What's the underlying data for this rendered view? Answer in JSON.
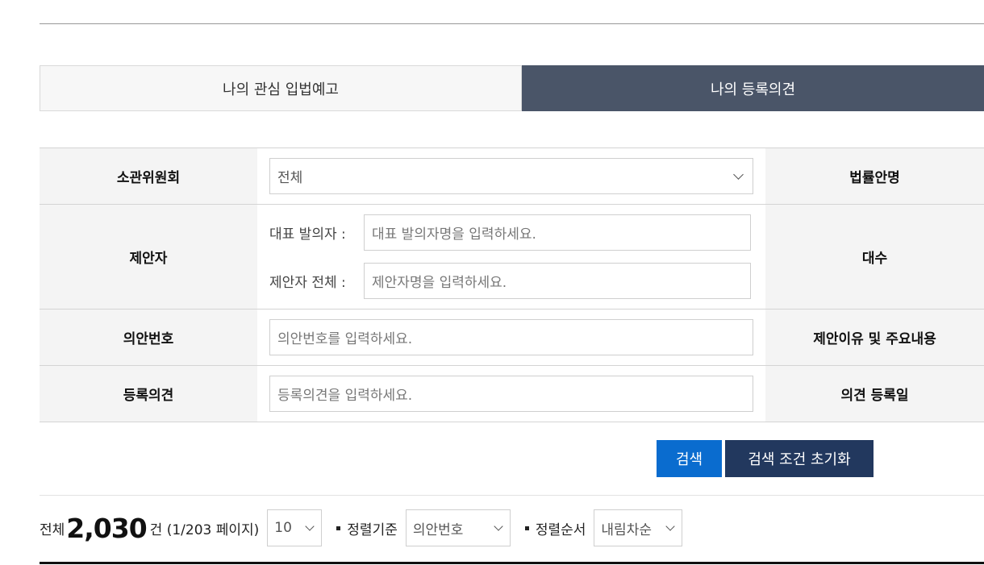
{
  "tabs": [
    {
      "label": "나의 관심 입법예고",
      "active": false
    },
    {
      "label": "나의 등록의견",
      "active": true
    }
  ],
  "form": {
    "committee_label": "소관위원회",
    "committee_value": "전체",
    "bill_name_label": "법률안명",
    "proposer_label": "제안자",
    "rep_proposer_label": "대표 발의자 :",
    "rep_proposer_placeholder": "대표 발의자명을 입력하세요.",
    "all_proposer_label": "제안자 전체 :",
    "all_proposer_placeholder": "제안자명을 입력하세요.",
    "session_label": "대수",
    "bill_no_label": "의안번호",
    "bill_no_placeholder": "의안번호를 입력하세요.",
    "reason_label": "제안이유 및 주요내용",
    "opinion_label": "등록의견",
    "opinion_placeholder": "등록의견을 입력하세요.",
    "opinion_date_label": "의견 등록일"
  },
  "buttons": {
    "search": "검색",
    "reset": "검색 조건 초기화"
  },
  "summary": {
    "total_prefix": "전체",
    "total_count": "2,030",
    "page_info": "건 (1/203 페이지)",
    "page_size": "10",
    "sort_by_label": "정렬기준",
    "sort_by_value": "의안번호",
    "sort_order_label": "정렬순서",
    "sort_order_value": "내림차순"
  },
  "colors": {
    "active_tab": "#4a5568",
    "search_button": "#0a6ccf",
    "reset_button": "#22385e"
  }
}
